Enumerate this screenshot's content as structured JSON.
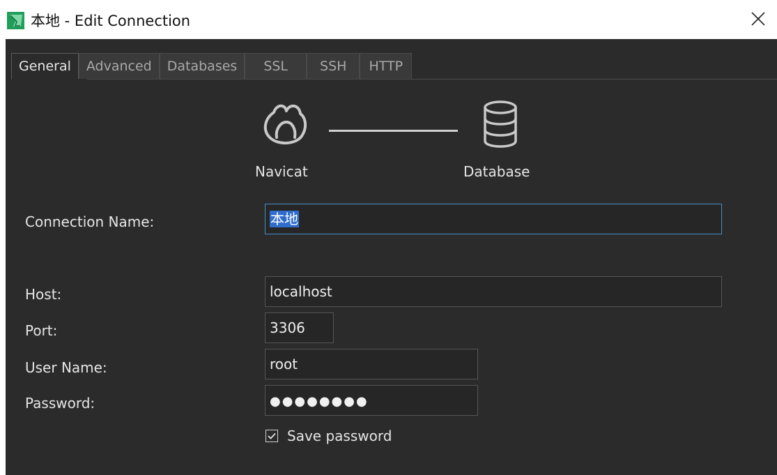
{
  "window": {
    "title": "本地 - Edit Connection",
    "app_icon": "navicat-app-icon",
    "close_icon": "close-icon"
  },
  "tabs": [
    {
      "label": "General",
      "active": true
    },
    {
      "label": "Advanced",
      "active": false
    },
    {
      "label": "Databases",
      "active": false
    },
    {
      "label": "SSL",
      "active": false
    },
    {
      "label": "SSH",
      "active": false
    },
    {
      "label": "HTTP",
      "active": false
    }
  ],
  "diagram": {
    "left_label": "Navicat",
    "right_label": "Database",
    "left_icon": "navicat-logo-icon",
    "right_icon": "database-icon"
  },
  "form": {
    "connection_name_label": "Connection Name:",
    "connection_name_value": "本地",
    "host_label": "Host:",
    "host_value": "localhost",
    "port_label": "Port:",
    "port_value": "3306",
    "username_label": "User Name:",
    "username_value": "root",
    "password_label": "Password:",
    "password_value": "●●●●●●●●",
    "save_password_label": "Save password",
    "save_password_checked": true
  },
  "colors": {
    "dialog_background": "#2b2b2b",
    "input_background": "#262626",
    "focus_border": "#4a90c8",
    "selection": "#2f6ccc",
    "text": "#e6e6e6"
  }
}
